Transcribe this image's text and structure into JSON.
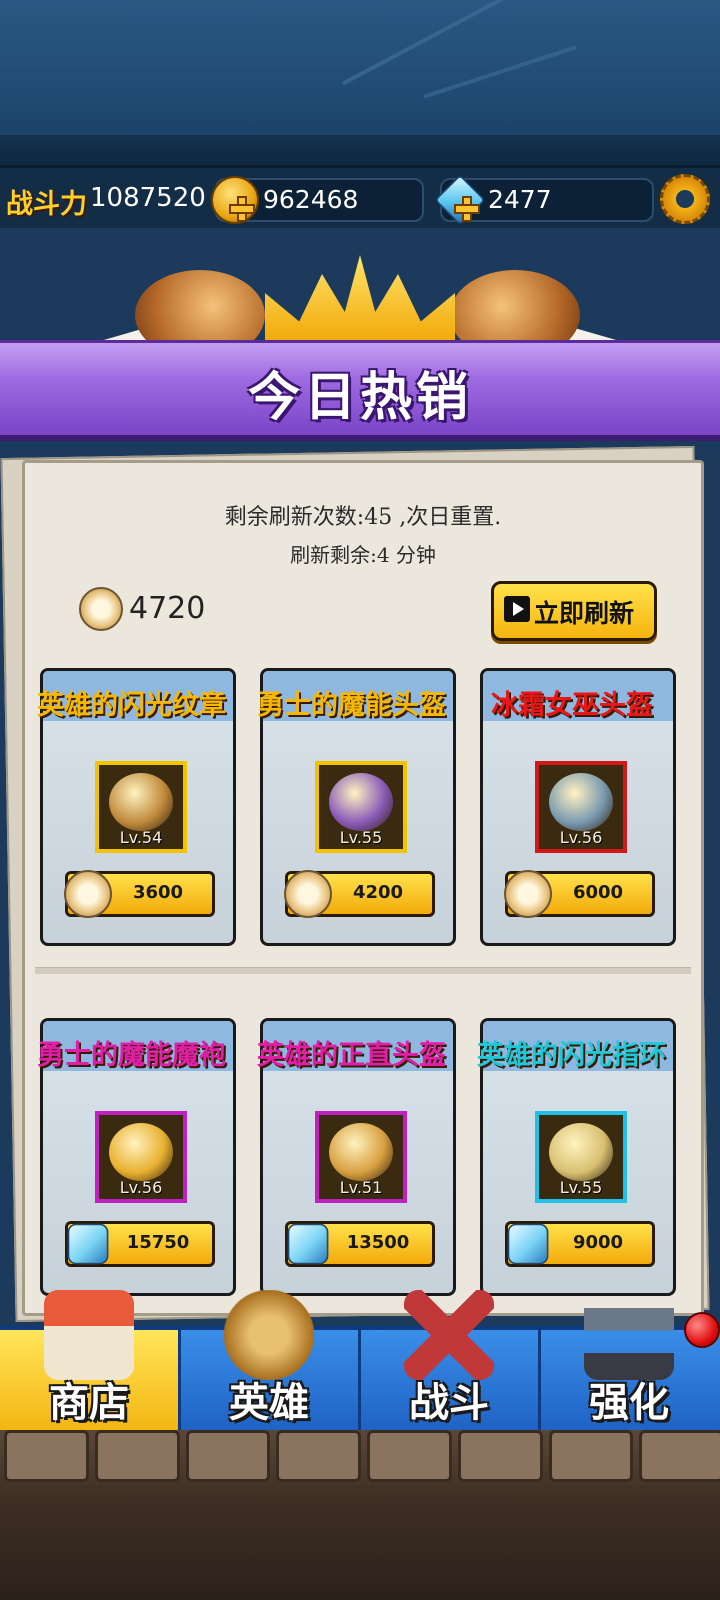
{
  "header": {
    "power_label": "战斗力",
    "power_value": "1087520",
    "gold": "962468",
    "gems": "2477",
    "settings_icon": "gear-icon"
  },
  "banner": {
    "title": "今日热销"
  },
  "shop": {
    "refresh_count_text": "剩余刷新次数:45 ,次日重置.",
    "refresh_timer_text": "刷新剩余:4 分钟",
    "honor_balance": "4720",
    "refresh_button_label": "立即刷新",
    "items": [
      {
        "name": "英雄的闪光纹章",
        "level": "Lv.54",
        "price": "3600",
        "currency": "honor-coin-icon",
        "name_color": "#f5b800",
        "frame_color": "#f2c400",
        "art_color": "#c08a3c",
        "art_icon": "dragon-emblem-icon"
      },
      {
        "name": "勇士的魔能头盔",
        "level": "Lv.55",
        "price": "4200",
        "currency": "honor-coin-icon",
        "name_color": "#f5b800",
        "frame_color": "#f2c400",
        "art_color": "#8a5bb8",
        "art_icon": "wizard-hat-icon"
      },
      {
        "name": "冰霜女巫头盔",
        "level": "Lv.56",
        "price": "6000",
        "currency": "honor-coin-icon",
        "name_color": "#e81818",
        "frame_color": "#d21818",
        "art_color": "#7a9ab0",
        "art_icon": "frost-helmet-icon"
      },
      {
        "name": "勇士的魔能魔袍",
        "level": "Lv.56",
        "price": "15750",
        "currency": "gem-icon",
        "name_color": "#e01ea8",
        "frame_color": "#c020c0",
        "art_color": "#e8b030",
        "art_icon": "golden-armor-icon"
      },
      {
        "name": "英雄的正直头盔",
        "level": "Lv.51",
        "price": "13500",
        "currency": "gem-icon",
        "name_color": "#e01ea8",
        "frame_color": "#c020c0",
        "art_color": "#d8a040",
        "art_icon": "knight-helmet-icon"
      },
      {
        "name": "英雄的闪光指环",
        "level": "Lv.55",
        "price": "9000",
        "currency": "gem-icon",
        "name_color": "#1fc8d8",
        "frame_color": "#20c0e8",
        "art_color": "#d8c070",
        "art_icon": "gold-ring-icon"
      }
    ]
  },
  "nav": {
    "tabs": [
      {
        "label": "商店",
        "icon": "shop-house-icon",
        "active": true
      },
      {
        "label": "英雄",
        "icon": "winged-helmet-icon",
        "active": false
      },
      {
        "label": "战斗",
        "icon": "crossed-swords-icon",
        "active": false
      },
      {
        "label": "强化",
        "icon": "hammer-anvil-icon",
        "active": false
      }
    ]
  }
}
